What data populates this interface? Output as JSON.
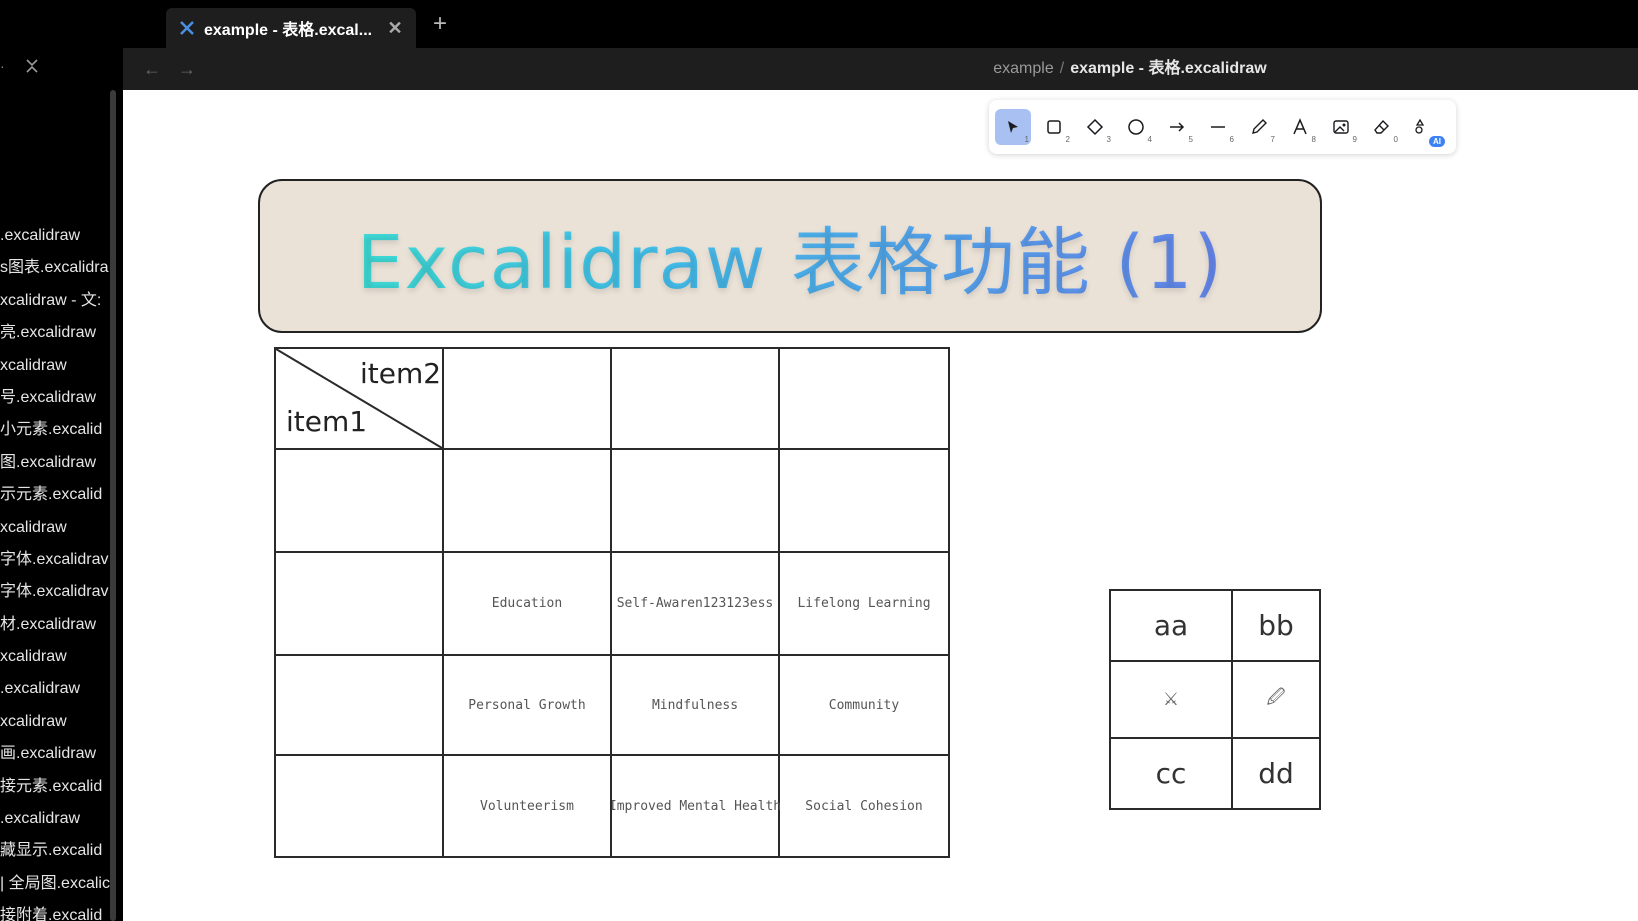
{
  "tab": {
    "title": "example - 表格.excal...",
    "close": "✕",
    "new": "+"
  },
  "nav": {
    "back": "←",
    "forward": "→"
  },
  "breadcrumb": {
    "parent": "example",
    "separator": "/",
    "current": "example - 表格.excalidraw"
  },
  "sidebar": {
    "files": [
      ".excalidraw",
      "s图表.excalidra",
      "xcalidraw - 文:",
      "亮.excalidraw",
      "xcalidraw",
      "号.excalidraw",
      "小元素.excalid",
      "图.excalidraw",
      "示元素.excalid",
      "xcalidraw",
      "字体.excalidrav",
      "字体.excalidrav",
      "材.excalidraw",
      "xcalidraw",
      ".excalidraw",
      "xcalidraw",
      "画.excalidraw",
      "接元素.excalid",
      ".excalidraw",
      "藏显示.excalid",
      "| 全局图.excalic",
      "接附着.excalid"
    ]
  },
  "toolbar": {
    "tools": [
      {
        "icon": "selection-arrow-icon",
        "key": "1"
      },
      {
        "icon": "rectangle-icon",
        "key": "2"
      },
      {
        "icon": "diamond-icon",
        "key": "3"
      },
      {
        "icon": "ellipse-icon",
        "key": "4"
      },
      {
        "icon": "arrow-icon",
        "key": "5"
      },
      {
        "icon": "line-icon",
        "key": "6"
      },
      {
        "icon": "pencil-icon",
        "key": "7"
      },
      {
        "icon": "text-icon",
        "key": "8"
      },
      {
        "icon": "image-icon",
        "key": "9"
      },
      {
        "icon": "eraser-icon",
        "key": "0"
      },
      {
        "icon": "shapes-ai-icon",
        "badge": "AI"
      }
    ]
  },
  "canvas": {
    "title": "Excalidraw 表格功能 (1)",
    "title_colors": [
      "#3ee8d2",
      "#44c1ee",
      "#6e7ef0"
    ],
    "banner_bg": "#eae2d7",
    "table": {
      "header_top_right": "item2",
      "header_bottom_left": "item1",
      "rows": [
        [
          "",
          "",
          "",
          ""
        ],
        [
          "",
          "",
          "",
          ""
        ],
        [
          "",
          "Education",
          "Self-Awaren123123ess",
          "Lifelong Learning"
        ],
        [
          "",
          "Personal Growth",
          "Mindfulness",
          "Community"
        ],
        [
          "",
          "Volunteerism",
          "Improved Mental Health",
          "Social Cohesion"
        ]
      ]
    },
    "small_table": {
      "rows": [
        [
          "aa",
          "bb"
        ],
        [
          "⚔",
          "🖉"
        ],
        [
          "cc",
          "dd"
        ]
      ]
    }
  }
}
